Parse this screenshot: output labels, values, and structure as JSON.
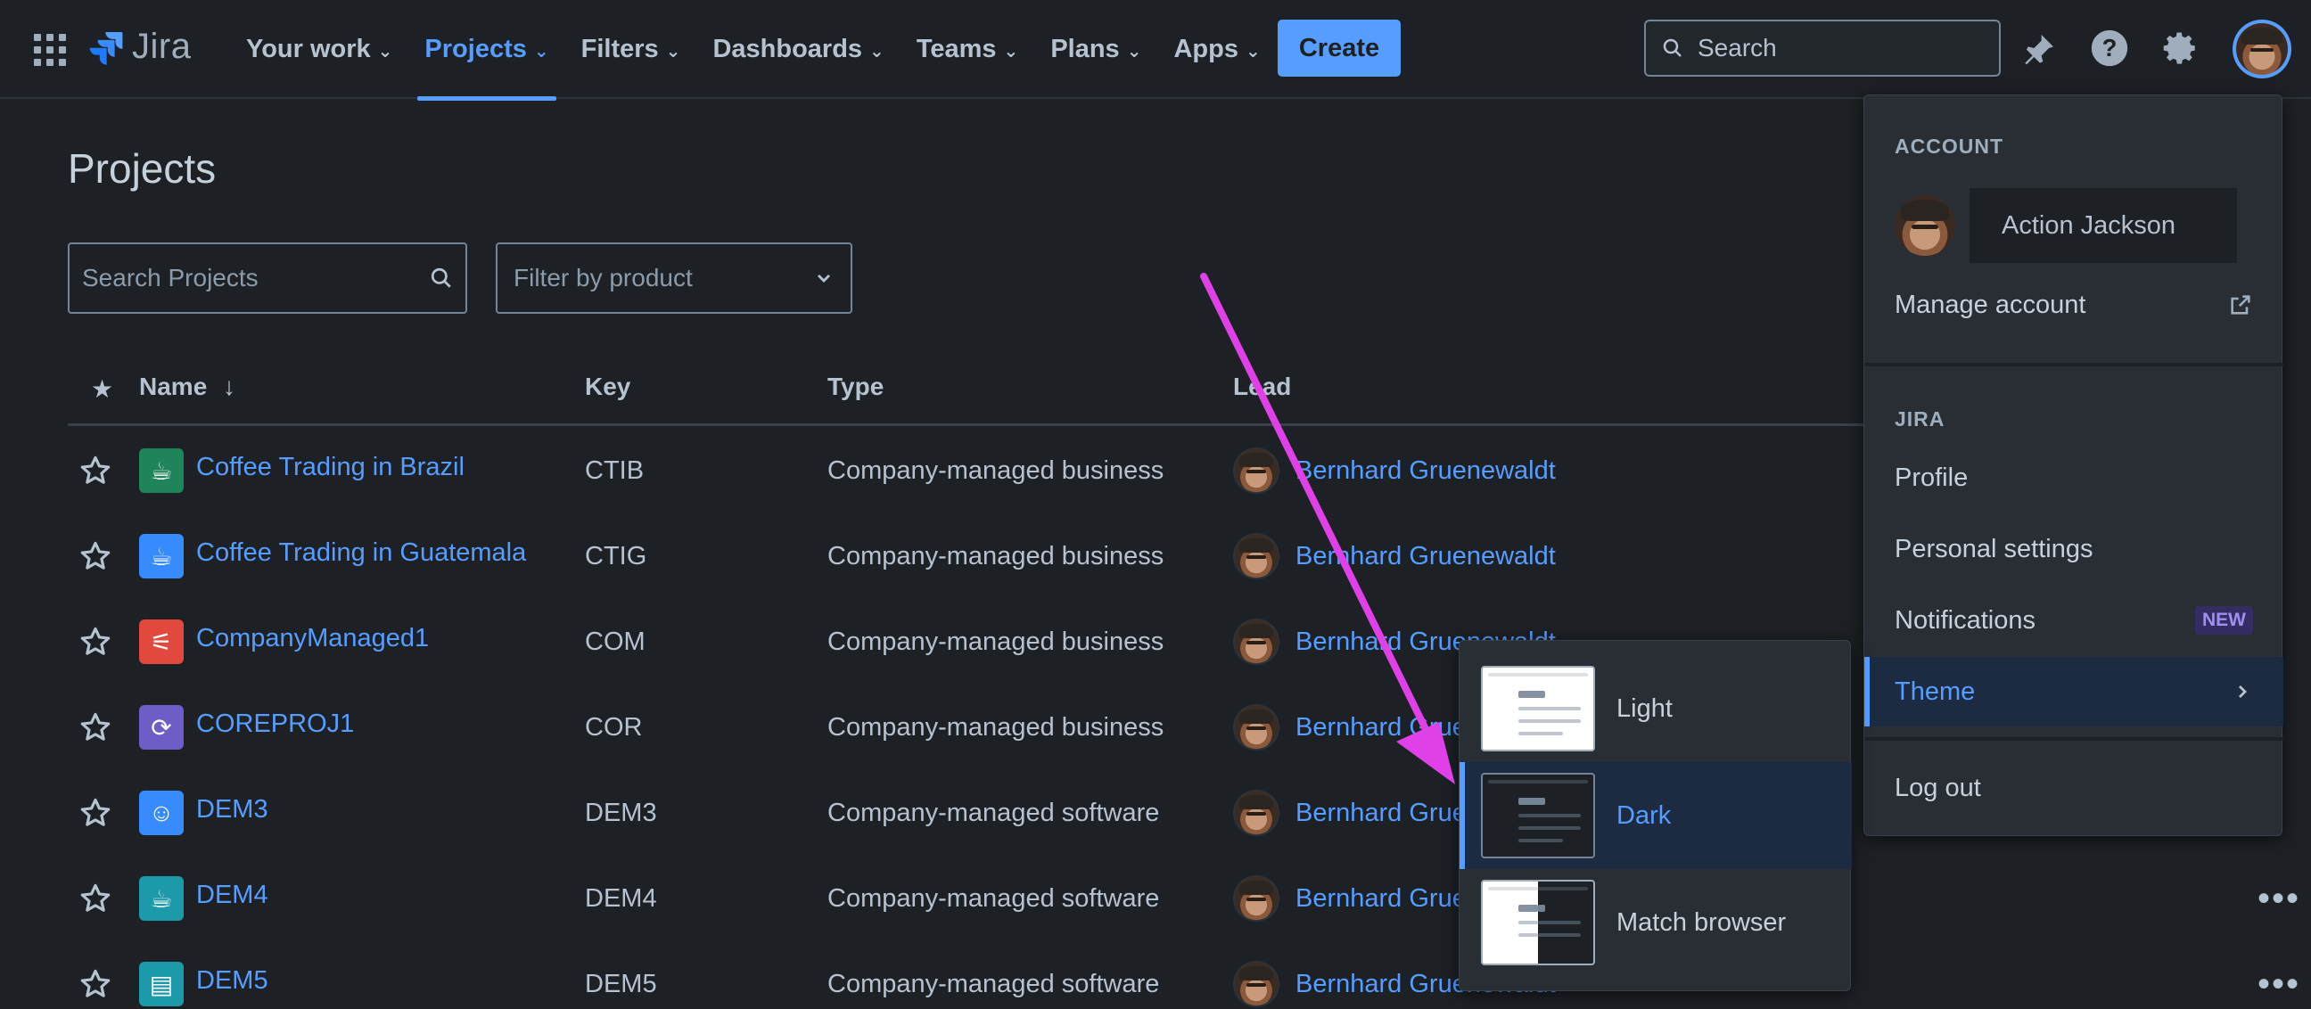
{
  "topnav": {
    "logo_text": "Jira",
    "items": [
      {
        "label": "Your work",
        "active": false
      },
      {
        "label": "Projects",
        "active": true
      },
      {
        "label": "Filters",
        "active": false
      },
      {
        "label": "Dashboards",
        "active": false
      },
      {
        "label": "Teams",
        "active": false
      },
      {
        "label": "Plans",
        "active": false
      },
      {
        "label": "Apps",
        "active": false
      }
    ],
    "create_label": "Create",
    "search_placeholder": "Search",
    "icons": [
      "app-switcher-icon",
      "notifications-icon",
      "help-icon",
      "settings-icon",
      "avatar"
    ]
  },
  "page": {
    "title": "Projects",
    "search_placeholder": "Search Projects",
    "filter_label": "Filter by product"
  },
  "table": {
    "headers": {
      "name": "Name",
      "key": "Key",
      "type": "Type",
      "lead": "Lead"
    },
    "rows": [
      {
        "name": "Coffee Trading in Brazil",
        "key": "CTIB",
        "type": "Company-managed business",
        "lead": "Bernhard Gruenewaldt",
        "icon_color": "#1f845a",
        "icon": "cup-icon"
      },
      {
        "name": "Coffee Trading in Guatemala",
        "key": "CTIG",
        "type": "Company-managed business",
        "lead": "Bernhard Gruenewaldt",
        "icon_color": "#388bff",
        "icon": "cup-icon"
      },
      {
        "name": "CompanyManaged1",
        "key": "COM",
        "type": "Company-managed business",
        "lead": "Bernhard Gruenewaldt",
        "icon_color": "#e2483d",
        "icon": "sliders-icon"
      },
      {
        "name": "COREPROJ1",
        "key": "COR",
        "type": "Company-managed business",
        "lead": "Bernhard Gruenewaldt",
        "icon_color": "#6e5dc6",
        "icon": "refresh-icon"
      },
      {
        "name": "DEM3",
        "key": "DEM3",
        "type": "Company-managed software",
        "lead": "Bernhard Gruenewaldt",
        "icon_color": "#388bff",
        "icon": "robot-icon"
      },
      {
        "name": "DEM4",
        "key": "DEM4",
        "type": "Company-managed software",
        "lead": "Bernhard Gruenewaldt",
        "icon_color": "#1d9aaa",
        "icon": "coffee-icon"
      },
      {
        "name": "DEM5",
        "key": "DEM5",
        "type": "Company-managed software",
        "lead": "Bernhard Gruenewaldt",
        "icon_color": "#1d9aaa",
        "icon": "cards-icon"
      }
    ]
  },
  "account_menu": {
    "account_heading": "ACCOUNT",
    "user_name": "Action Jackson",
    "manage_account": "Manage account",
    "jira_heading": "JIRA",
    "profile": "Profile",
    "personal_settings": "Personal settings",
    "notifications": "Notifications",
    "notifications_badge": "NEW",
    "theme": "Theme",
    "log_out": "Log out"
  },
  "theme_menu": {
    "options": [
      {
        "label": "Light",
        "selected": false
      },
      {
        "label": "Dark",
        "selected": true
      },
      {
        "label": "Match browser",
        "selected": false
      }
    ]
  },
  "colors": {
    "accent": "#579dff",
    "background": "#1d2125",
    "annotation_arrow": "#e040e8"
  }
}
